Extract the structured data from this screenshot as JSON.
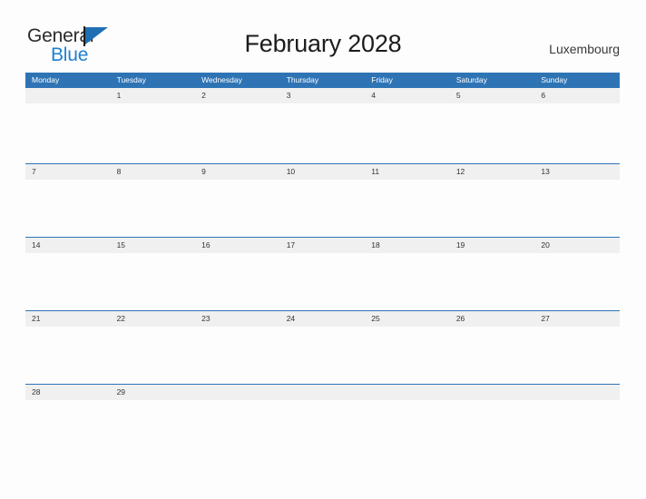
{
  "brand": {
    "name_part1": "General",
    "name_part2": "Blue",
    "flag_icon": "blue-triangle-flag-icon",
    "color_dark": "#2b2b2b",
    "color_blue": "#1f7fd0"
  },
  "header": {
    "title": "February 2028",
    "location": "Luxembourg"
  },
  "calendar": {
    "month": "February",
    "year": "2028",
    "accent_color": "#2e74b5",
    "band_color": "#f0f0f0",
    "weekdays": [
      "Monday",
      "Tuesday",
      "Wednesday",
      "Thursday",
      "Friday",
      "Saturday",
      "Sunday"
    ],
    "weeks": [
      [
        "",
        "1",
        "2",
        "3",
        "4",
        "5",
        "6"
      ],
      [
        "7",
        "8",
        "9",
        "10",
        "11",
        "12",
        "13"
      ],
      [
        "14",
        "15",
        "16",
        "17",
        "18",
        "19",
        "20"
      ],
      [
        "21",
        "22",
        "23",
        "24",
        "25",
        "26",
        "27"
      ],
      [
        "28",
        "29",
        "",
        "",
        "",
        "",
        ""
      ]
    ]
  }
}
